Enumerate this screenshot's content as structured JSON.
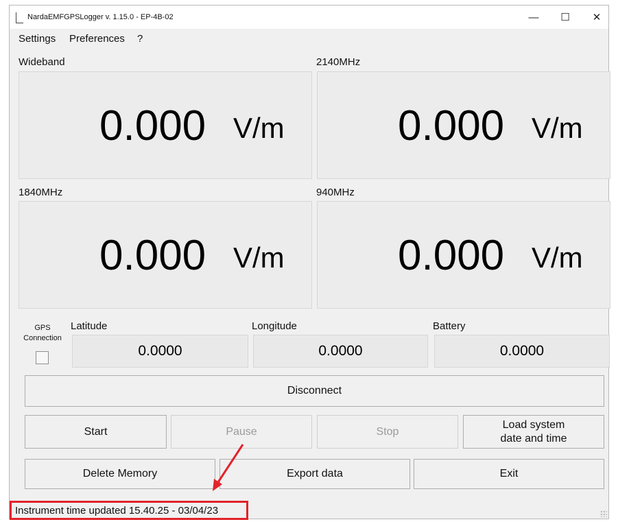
{
  "window": {
    "title": "NardaEMFGPSLogger v. 1.15.0 - EP-4B-02",
    "minimize_glyph": "—",
    "maximize_glyph": "☐",
    "close_glyph": "✕"
  },
  "menu": {
    "items": [
      "Settings",
      "Preferences",
      "?"
    ]
  },
  "readings": [
    {
      "label": "Wideband",
      "value": "0.000",
      "unit": "V/m"
    },
    {
      "label": "2140MHz",
      "value": "0.000",
      "unit": "V/m"
    },
    {
      "label": "1840MHz",
      "value": "0.000",
      "unit": "V/m"
    },
    {
      "label": "940MHz",
      "value": "0.000",
      "unit": "V/m"
    }
  ],
  "gps": {
    "label_line1": "GPS",
    "label_line2": "Connection",
    "checked": false
  },
  "fields": [
    {
      "label": "Latitude",
      "value": "0.0000"
    },
    {
      "label": "Longitude",
      "value": "0.0000"
    },
    {
      "label": "Battery",
      "value": "0.0000"
    }
  ],
  "buttons": {
    "disconnect": "Disconnect",
    "start": "Start",
    "pause": "Pause",
    "stop": "Stop",
    "load_time_line1": "Load system",
    "load_time_line2": "date and time",
    "delete_memory": "Delete Memory",
    "export_data": "Export data",
    "exit": "Exit"
  },
  "status": {
    "text": "Instrument time updated 15.40.25 - 03/04/23"
  },
  "colors": {
    "annotation": "#e2232a",
    "window_bg": "#f0f0f0",
    "panel_bg": "#ececec"
  }
}
